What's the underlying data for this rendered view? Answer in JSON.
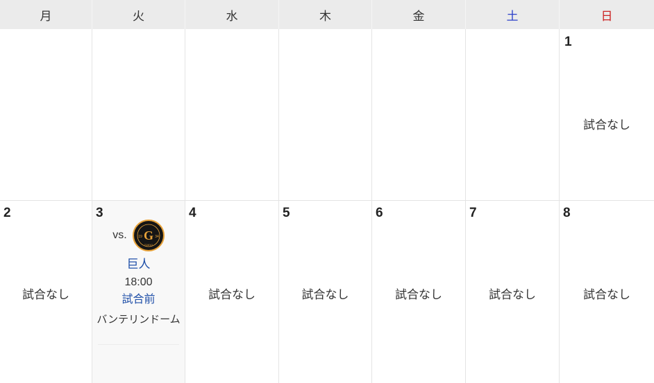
{
  "weekdays": [
    {
      "label": "月",
      "color": "#333333"
    },
    {
      "label": "火",
      "color": "#333333"
    },
    {
      "label": "水",
      "color": "#333333"
    },
    {
      "label": "木",
      "color": "#333333"
    },
    {
      "label": "金",
      "color": "#333333"
    },
    {
      "label": "土",
      "color": "#2a3fc9"
    },
    {
      "label": "日",
      "color": "#cc2222"
    }
  ],
  "weeks": [
    {
      "days": [
        {
          "number": "",
          "status": ""
        },
        {
          "number": "",
          "status": ""
        },
        {
          "number": "",
          "status": ""
        },
        {
          "number": "",
          "status": ""
        },
        {
          "number": "",
          "status": ""
        },
        {
          "number": "",
          "status": ""
        },
        {
          "number": "1",
          "status": "試合なし"
        }
      ]
    },
    {
      "days": [
        {
          "number": "2",
          "status": "試合なし"
        },
        {
          "number": "3",
          "status": ""
        },
        {
          "number": "4",
          "status": "試合なし"
        },
        {
          "number": "5",
          "status": "試合なし"
        },
        {
          "number": "6",
          "status": "試合なし"
        },
        {
          "number": "7",
          "status": "試合なし"
        },
        {
          "number": "8",
          "status": "試合なし"
        }
      ]
    }
  ],
  "game": {
    "vs_label": "vs.",
    "opponent": "巨人",
    "time": "18:00",
    "status": "試合前",
    "venue": "バンテリンドーム",
    "logo_icon": "giants-logo-icon",
    "logo_text": "G",
    "logo_year_left": "19",
    "logo_year_right": "34",
    "logo_city": "TOKYO"
  },
  "colors": {
    "header_bg": "#ebebeb",
    "link_blue": "#1f4fa8",
    "saturday": "#2a3fc9",
    "sunday": "#cc2222",
    "logo_orange": "#e8a33a"
  }
}
